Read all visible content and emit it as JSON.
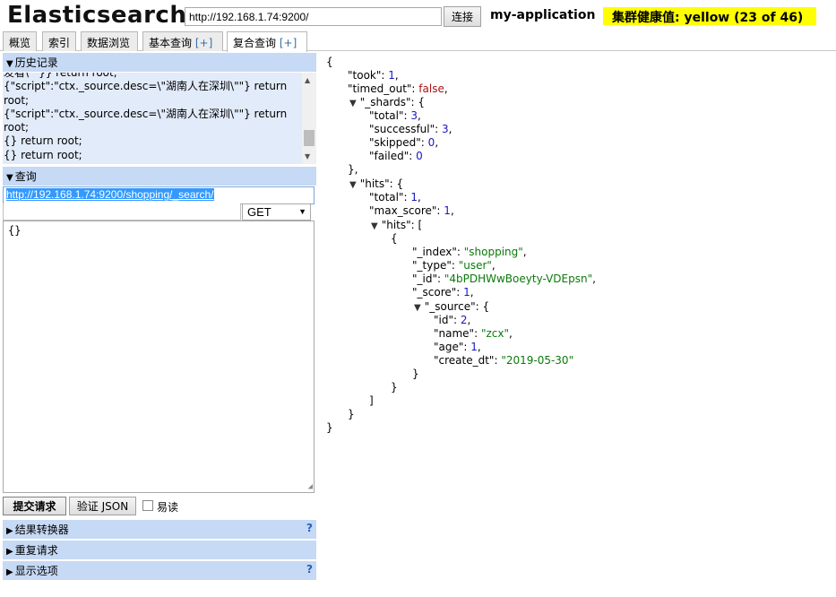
{
  "header": {
    "title": "Elasticsearch",
    "url": "http://192.168.1.74:9200/",
    "connect_label": "连接",
    "cluster_name": "my-application",
    "health": "集群健康值: yellow (23 of 46)"
  },
  "tabs": [
    {
      "label": "概览"
    },
    {
      "label": "索引"
    },
    {
      "label": "数据浏览"
    },
    {
      "label": "基本查询",
      "plus": "[+]"
    },
    {
      "label": "复合查询",
      "plus": "[+]"
    }
  ],
  "history": {
    "title": "历史记录",
    "items": [
      "发看\\\"\"}} return root;",
      "{\"script\":\"ctx._source.desc=\\\"湖南人在深圳\\\"\"} return root;",
      "{\"script\":\"ctx._source.desc=\\\"湖南人在深圳\\\"\"} return root;",
      "{} return root;",
      "{} return root;"
    ]
  },
  "query": {
    "title": "查询",
    "url": "http://192.168.1.74:9200/shopping/_search/",
    "path": "",
    "method": "GET",
    "body": "{}"
  },
  "actions": {
    "submit_label": "提交请求",
    "validate_label": "验证 JSON",
    "readonly_label": "易读"
  },
  "panels": [
    {
      "label": "结果转换器",
      "help": "?"
    },
    {
      "label": "重复请求"
    },
    {
      "label": "显示选项",
      "help": "?"
    }
  ],
  "output": {
    "lines": [
      {
        "pre": "{"
      },
      {
        "key": "\"took\"",
        "val": "1",
        "type": "n",
        "post": ","
      },
      {
        "key": "\"timed_out\"",
        "val": "false",
        "type": "b",
        "post": ","
      },
      {
        "toggle": "▼",
        "key": "\"_shards\"",
        "pre": "{"
      },
      {
        "key": "\"total\"",
        "val": "3",
        "type": "n",
        "post": ","
      },
      {
        "key": "\"successful\"",
        "val": "3",
        "type": "n",
        "post": ","
      },
      {
        "key": "\"skipped\"",
        "val": "0",
        "type": "n",
        "post": ","
      },
      {
        "key": "\"failed\"",
        "val": "0",
        "type": "n"
      },
      {
        "pre": "},"
      },
      {
        "toggle": "▼",
        "key": "\"hits\"",
        "pre": "{"
      },
      {
        "key": "\"total\"",
        "val": "1",
        "type": "n",
        "post": ","
      },
      {
        "key": "\"max_score\"",
        "val": "1",
        "type": "n",
        "post": ","
      },
      {
        "toggle": "▼",
        "key": "\"hits\"",
        "pre": "["
      },
      {
        "pre": "{"
      },
      {
        "key": "\"_index\"",
        "val": "\"shopping\"",
        "type": "s",
        "post": ","
      },
      {
        "key": "\"_type\"",
        "val": "\"user\"",
        "type": "s",
        "post": ","
      },
      {
        "key": "\"_id\"",
        "val": "\"4bPDHWwBoeyty-VDEpsn\"",
        "type": "s",
        "post": ","
      },
      {
        "key": "\"_score\"",
        "val": "1",
        "type": "n",
        "post": ","
      },
      {
        "toggle": "▼",
        "key": "\"_source\"",
        "pre": "{"
      },
      {
        "key": "\"id\"",
        "val": "2",
        "type": "n",
        "post": ","
      },
      {
        "key": "\"name\"",
        "val": "\"zcx\"",
        "type": "s",
        "post": ","
      },
      {
        "key": "\"age\"",
        "val": "1",
        "type": "n",
        "post": ","
      },
      {
        "key": "\"create_dt\"",
        "val": "\"2019-05-30\"",
        "type": "s"
      },
      {
        "pre": "}"
      },
      {
        "pre": "}"
      },
      {
        "pre": "]"
      },
      {
        "pre": "}"
      },
      {
        "pre": "}"
      }
    ]
  }
}
